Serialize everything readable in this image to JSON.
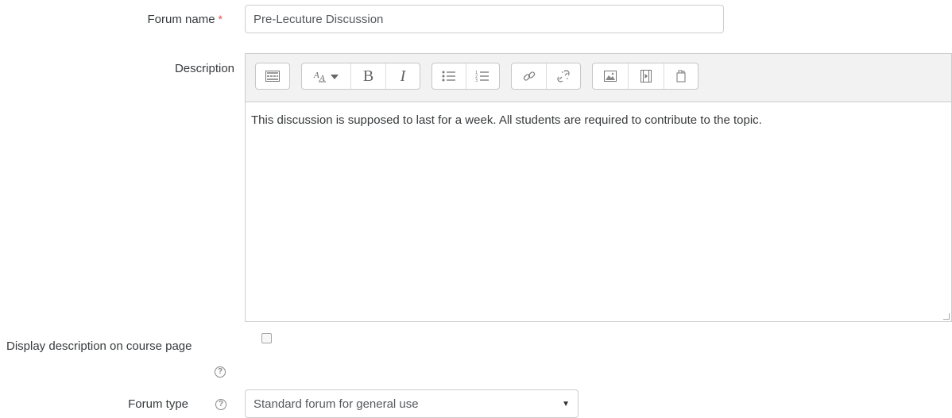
{
  "forum_name": {
    "label": "Forum name",
    "required_marker": "*",
    "value": "Pre-Lecuture Discussion"
  },
  "description": {
    "label": "Description",
    "text": "This discussion is supposed to last for a week. All students are required to contribute to the topic.",
    "toolbar": {
      "bold": "B",
      "italic": "I"
    }
  },
  "display_description": {
    "label": "Display description on course page",
    "checked": false,
    "help_icon": "?"
  },
  "forum_type": {
    "label": "Forum type",
    "help_icon": "?",
    "selected": "Standard forum for general use"
  }
}
